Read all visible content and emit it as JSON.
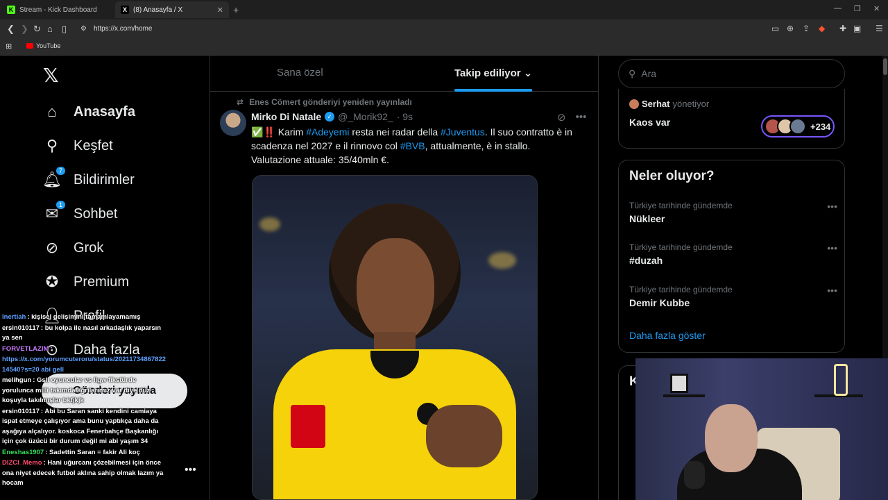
{
  "browser": {
    "tabs": [
      {
        "title": "Stream - Kick Dashboard",
        "favicon": "K"
      },
      {
        "title": "(8) Anasayfa / X",
        "favicon": "X"
      }
    ],
    "url": "https://x.com/home",
    "bookmarks": [
      {
        "label": "YouTube"
      }
    ]
  },
  "nav": {
    "items": [
      {
        "label": "Anasayfa",
        "icon": "home-icon"
      },
      {
        "label": "Keşfet",
        "icon": "search-icon"
      },
      {
        "label": "Bildirimler",
        "icon": "bell-icon",
        "badge": "7"
      },
      {
        "label": "Sohbet",
        "icon": "mail-icon",
        "badge": "1"
      },
      {
        "label": "Grok",
        "icon": "grok-icon"
      },
      {
        "label": "Premium",
        "icon": "premium-icon"
      },
      {
        "label": "Profil",
        "icon": "profile-icon"
      },
      {
        "label": "Daha fazla",
        "icon": "more-circle-icon"
      }
    ],
    "post_button": "Gönderi yayınla"
  },
  "feed": {
    "tabs": [
      {
        "label": "Sana özel",
        "active": false
      },
      {
        "label": "Takip ediliyor",
        "active": true
      }
    ],
    "tweet": {
      "reposted_by": "Enes Cömert gönderiyi yeniden yayınladı",
      "name": "Mirko Di Natale",
      "handle": "@_Morik92_",
      "time": "· 9s",
      "text_parts": {
        "p1": "✅",
        "p2": "‼️",
        "p3": " Karim ",
        "p4": "#Adeyemi",
        "p5": " resta nei radar della ",
        "p6": "#Juventus",
        "p7": ". Il suo contratto è in scadenza nel 2027 e il rinnovo col ",
        "p8": "#BVB",
        "p9": ", attualmente, è in stallo.",
        "p10": "Valutazione attuale: 35/40mln €."
      }
    }
  },
  "sidebar": {
    "search_placeholder": "Ara",
    "community": {
      "by_name": "Serhat",
      "by_suffix": "yönetiyor",
      "title": "Kaos var",
      "member_count": "+234"
    },
    "trends": {
      "title": "Neler oluyor?",
      "items": [
        {
          "context": "Türkiye tarihinde gündemde",
          "name": "Nükleer"
        },
        {
          "context": "Türkiye tarihinde gündemde",
          "name": "#duzah"
        },
        {
          "context": "Türkiye tarihinde gündemde",
          "name": "Demir Kubbe"
        }
      ],
      "show_more": "Daha fazla göster"
    },
    "next_card_initial": "K"
  },
  "chat": {
    "messages": [
      {
        "user": "Inertiah",
        "color": "#5ea0ff",
        "text": ": kişisel gelişimini tamamlayamamış"
      },
      {
        "user": "ersin010117",
        "color": "#ffffff",
        "text": ": bu kolpa ile nasıl arkadaşlık yaparsın ya sen"
      },
      {
        "user": "FORVETLAZIM",
        "color": "#c77dff",
        "text": ":"
      },
      {
        "user": "",
        "color": "#5ea0ff",
        "text": "https://x.com/yorumcuteroru/status/2021173486782214540?s=20 abi gell"
      },
      {
        "user": "melihgun",
        "color": "#ffffff",
        "text": ": Gsli oyuncular vs ligw fikstürde yorulunca milli takımda ağrılarımız var diye düz koşuyla takılmışlar bkfjkjk"
      },
      {
        "user": "ersin010117",
        "color": "#ffffff",
        "text": ": Abi bu Saran sanki kendini camiaya ispat etmeye çalışıyor ama bunu yaptıkça daha da aşağıya alçalıyor. koskoca Fenerbahçe Başkanlığı için çok üzücü bir durum değil mi abi yaşım 34"
      },
      {
        "user": "Eneshas1907",
        "color": "#36e05a",
        "text": ": Sadettin Saran = fakir Ali koç"
      },
      {
        "user": "DIZCI_Memo",
        "color": "#ff4d6d",
        "text": ": Hani uğurcanı çözebilmesi için önce ona niyet edecek futbol aklına sahip olmak lazım ya hocam"
      }
    ]
  },
  "colors": {
    "accent": "#1d9bf0",
    "background": "#000000",
    "text": "#e7e9ea",
    "muted": "#71767b",
    "border": "#2f3336",
    "community_ring": "#7856ff"
  }
}
